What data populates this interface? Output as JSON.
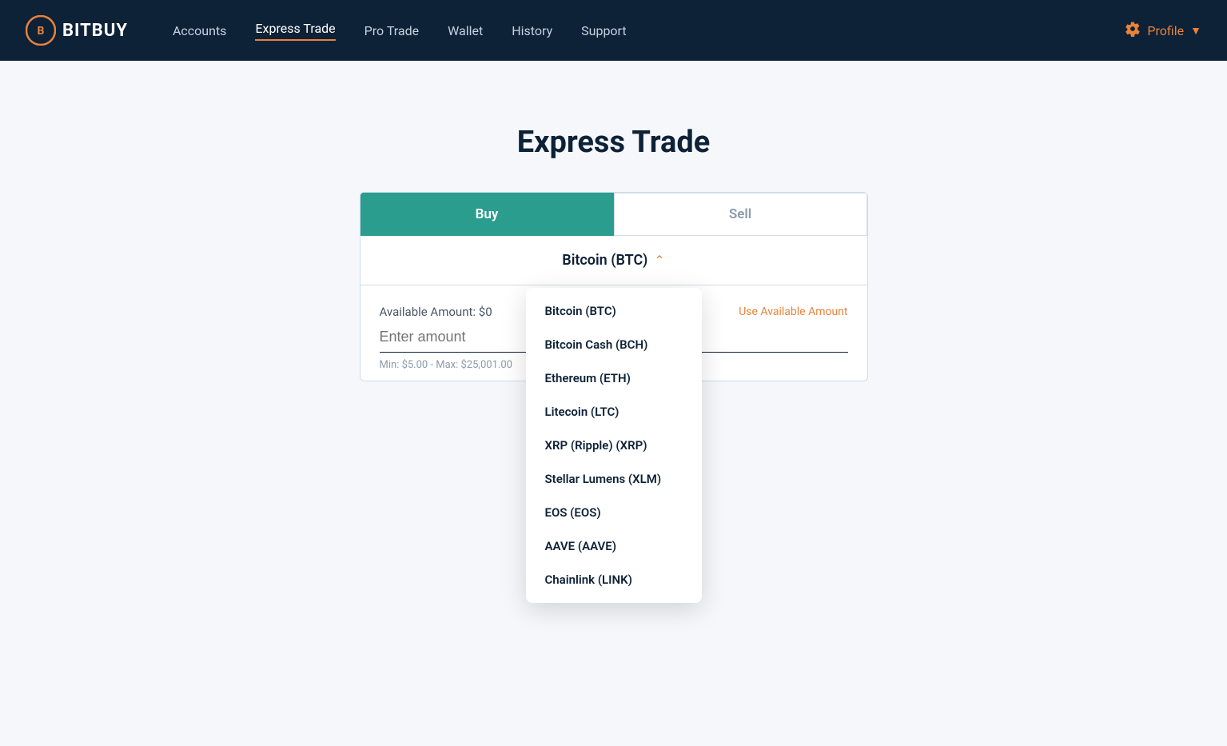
{
  "brand": {
    "name": "BITBUY"
  },
  "nav": {
    "links": [
      {
        "id": "accounts",
        "label": "Accounts",
        "active": false
      },
      {
        "id": "express-trade",
        "label": "Express Trade",
        "active": true
      },
      {
        "id": "pro-trade",
        "label": "Pro Trade",
        "active": false
      },
      {
        "id": "wallet",
        "label": "Wallet",
        "active": false
      },
      {
        "id": "history",
        "label": "History",
        "active": false
      },
      {
        "id": "support",
        "label": "Support",
        "active": false
      }
    ],
    "profile_label": "Profile"
  },
  "page": {
    "title": "Express Trade"
  },
  "trade": {
    "buy_label": "Buy",
    "sell_label": "Sell",
    "selected_currency": "Bitcoin (BTC)",
    "chevron_up": "^",
    "available_label": "Available Amount:",
    "available_amount": "$0",
    "use_available_label": "Use Available Amount",
    "enter_amount_placeholder": "Enter amount",
    "amount_hint": "Min: $5.00 - Max: $25,001.00",
    "dropdown_items": [
      {
        "id": "btc",
        "label": "Bitcoin (BTC)"
      },
      {
        "id": "bch",
        "label": "Bitcoin Cash (BCH)"
      },
      {
        "id": "eth",
        "label": "Ethereum (ETH)"
      },
      {
        "id": "ltc",
        "label": "Litecoin (LTC)"
      },
      {
        "id": "xrp",
        "label": "XRP (Ripple) (XRP)"
      },
      {
        "id": "xlm",
        "label": "Stellar Lumens (XLM)"
      },
      {
        "id": "eos",
        "label": "EOS (EOS)"
      },
      {
        "id": "aave",
        "label": "AAVE (AAVE)"
      },
      {
        "id": "link",
        "label": "Chainlink (LINK)"
      }
    ]
  }
}
